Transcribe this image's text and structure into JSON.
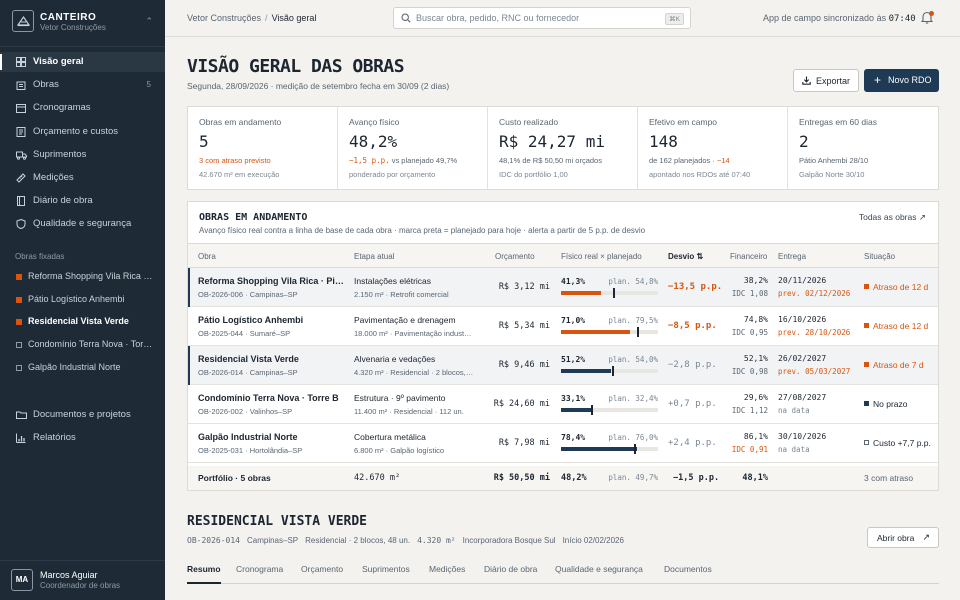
{
  "brand": {
    "name": "CANTEIRO",
    "org": "Vetor Construções",
    "switch_icon": "chevron-updown-icon"
  },
  "nav": [
    {
      "label": "Visão geral",
      "icon": "grid-icon",
      "active": true
    },
    {
      "label": "Obras",
      "icon": "building-icon",
      "count": "5"
    },
    {
      "label": "Cronogramas",
      "icon": "calendar-icon"
    },
    {
      "label": "Orçamento e custos",
      "icon": "ledger-icon"
    },
    {
      "label": "Suprimentos",
      "icon": "truck-icon"
    },
    {
      "label": "Medições",
      "icon": "ruler-icon"
    },
    {
      "label": "Diário de obra",
      "icon": "notebook-icon"
    },
    {
      "label": "Qualidade e segurança",
      "icon": "shield-icon"
    }
  ],
  "pinned_title": "Obras fixadas",
  "pinned": [
    {
      "label": "Reforma Shopping Vila Rica · Piso…",
      "color": "#d8550f"
    },
    {
      "label": "Pátio Logístico Anhembi",
      "color": "#d8550f"
    },
    {
      "label": "Residencial Vista Verde",
      "color": "#d8550f",
      "active": true
    },
    {
      "label": "Condomínio Terra Nova · Torr…",
      "color": "outline"
    },
    {
      "label": "Galpão Industrial Norte",
      "color": "outline"
    }
  ],
  "nav_bottom": [
    {
      "label": "Documentos e projetos",
      "icon": "folder-icon"
    },
    {
      "label": "Relatórios",
      "icon": "bar-chart-icon"
    }
  ],
  "user": {
    "initials": "MA",
    "name": "Marcos Aguiar",
    "role": "Coordenador de obras"
  },
  "topbar": {
    "breadcrumb_org": "Vetor Construções",
    "breadcrumb_sep": "/",
    "breadcrumb_current": "Visão geral",
    "search_placeholder": "Buscar obra, pedido, RNC ou fornecedor",
    "search_shortcut": "⌘K",
    "sync_label": "App de campo sincronizado às",
    "sync_time": "07:40"
  },
  "header": {
    "title": "VISÃO GERAL DAS OBRAS",
    "subtitle": "Segunda, 28/09/2026 · medição de setembro fecha em 30/09 (2 dias)",
    "export_label": "Exportar",
    "new_label": "Novo RDO"
  },
  "kpis": [
    {
      "label": "Obras em andamento",
      "value": "5",
      "line1": "3 com atraso previsto",
      "line1_accent": true,
      "line2": "42.670 m² em execução"
    },
    {
      "label": "Avanço físico",
      "value": "48,2%",
      "line1_accent_part": "−1,5 p.p.",
      "line1_rest": " vs planejado 49,7%",
      "line2": "ponderado por orçamento"
    },
    {
      "label": "Custo realizado",
      "value": "R$ 24,27 mi",
      "line1": "48,1% de R$ 50,50 mi orçados",
      "line2": "IDC do portfólio 1,00"
    },
    {
      "label": "Efetivo em campo",
      "value": "148",
      "line1_pre": "de 162 planejados · ",
      "line1_accent_tail": "−14",
      "line2": "apontado nos RDOs até 07:40"
    },
    {
      "label": "Entregas em 60 dias",
      "value": "2",
      "line1": "Pátio Anhembi 28/10",
      "line2": "Galpão Norte 30/10"
    }
  ],
  "table": {
    "title": "OBRAS EM ANDAMENTO",
    "subtitle": "Avanço físico real contra a linha de base de cada obra · marca preta = planejado para hoje · alerta a partir de 5 p.p. de desvio",
    "link": "Todas as obras",
    "columns": {
      "obra": "Obra",
      "etapa": "Etapa atual",
      "orcamento": "Orçamento",
      "fisico": "Físico real × planejado",
      "desvio": "Desvio",
      "financeiro": "Financeiro",
      "entrega": "Entrega",
      "situacao": "Situação"
    },
    "rows": [
      {
        "name": "Reforma Shopping Vila Rica · Piso…",
        "code": "OB-2026-006 · Campinas–SP",
        "stage": "Instalações elétricas",
        "stage2": "2.150 m² · Retrofit comercial",
        "budget": "R$ 3,12 mi",
        "real": "41,3%",
        "plan": "plan. 54,8%",
        "real_pct": 41.3,
        "plan_pct": 54.8,
        "dev": "−13,5 p.p.",
        "dev_alert": true,
        "fin": "38,2%",
        "idc": "IDC 1,08",
        "idc_alert": false,
        "delivery": "20/11/2026",
        "delivery2": "prev. 02/12/2026",
        "delivery2_alert": true,
        "status": "Atraso de 12 d",
        "status_kind": "late",
        "selected": true
      },
      {
        "name": "Pátio Logístico Anhembi",
        "code": "OB-2025-044 · Sumaré–SP",
        "stage": "Pavimentação e drenagem",
        "stage2": "18.000 m² · Pavimentação indust…",
        "budget": "R$ 5,34 mi",
        "real": "71,0%",
        "plan": "plan. 79,5%",
        "real_pct": 71.0,
        "plan_pct": 79.5,
        "dev": "−8,5 p.p.",
        "dev_alert": true,
        "fin": "74,8%",
        "idc": "IDC 0,95",
        "idc_alert": false,
        "delivery": "16/10/2026",
        "delivery2": "prev. 28/10/2026",
        "delivery2_alert": true,
        "status": "Atraso de 12 d",
        "status_kind": "late",
        "selected": false
      },
      {
        "name": "Residencial Vista Verde",
        "code": "OB-2026-014 · Campinas–SP",
        "stage": "Alvenaria e vedações",
        "stage2": "4.320 m² · Residencial · 2 blocos,…",
        "budget": "R$ 9,46 mi",
        "real": "51,2%",
        "plan": "plan. 54,0%",
        "real_pct": 51.2,
        "plan_pct": 54.0,
        "dev": "−2,8 p.p.",
        "dev_alert": false,
        "fin": "52,1%",
        "idc": "IDC 0,98",
        "idc_alert": false,
        "delivery": "26/02/2027",
        "delivery2": "prev. 05/03/2027",
        "delivery2_alert": true,
        "status": "Atraso de 7 d",
        "status_kind": "late",
        "selected": true
      },
      {
        "name": "Condomínio Terra Nova · Torre B",
        "code": "OB-2026-002 · Valinhos–SP",
        "stage": "Estrutura · 9º pavimento",
        "stage2": "11.400 m² · Residencial · 112 un.",
        "budget": "R$ 24,60 mi",
        "real": "33,1%",
        "plan": "plan. 32,4%",
        "real_pct": 33.1,
        "plan_pct": 32.4,
        "dev": "+0,7 p.p.",
        "dev_alert": false,
        "fin": "29,6%",
        "idc": "IDC 1,12",
        "idc_alert": false,
        "delivery": "27/08/2027",
        "delivery2": "na data",
        "delivery2_alert": false,
        "status": "No prazo",
        "status_kind": "ok",
        "selected": false
      },
      {
        "name": "Galpão Industrial Norte",
        "code": "OB-2025-031 · Hortolândia–SP",
        "stage": "Cobertura metálica",
        "stage2": "6.800 m² · Galpão logístico",
        "budget": "R$ 7,98 mi",
        "real": "78,4%",
        "plan": "plan. 76,0%",
        "real_pct": 78.4,
        "plan_pct": 76.0,
        "dev": "+2,4 p.p.",
        "dev_alert": false,
        "fin": "86,1%",
        "idc": "IDC 0,91",
        "idc_alert": true,
        "delivery": "30/10/2026",
        "delivery2": "na data",
        "delivery2_alert": false,
        "status": "Custo +7,7 p.p.",
        "status_kind": "cost",
        "selected": false
      }
    ],
    "footer": {
      "label": "Portfólio · 5 obras",
      "area": "42.670 m²",
      "budget": "R$ 50,50 mi",
      "real": "48,2%",
      "plan": "plan. 49,7%",
      "dev": "−1,5 p.p.",
      "fin": "48,1%",
      "status": "3 com atraso"
    }
  },
  "detail": {
    "title": "RESIDENCIAL VISTA VERDE",
    "code": "OB-2026-014",
    "city": "Campinas–SP",
    "type": "Residencial · 2 blocos, 48 un.",
    "area": "4.320 m²",
    "client": "Incorporadora Bosque Sul",
    "start": "Início 02/02/2026",
    "open_label": "Abrir obra",
    "tabs": [
      "Resumo",
      "Cronograma",
      "Orçamento",
      "Suprimentos",
      "Medições",
      "Diário de obra",
      "Qualidade e segurança",
      "Documentos"
    ]
  },
  "colors": {
    "accent": "#d8550f",
    "navy": "#1e3a55",
    "sidebar": "#1e2a35",
    "ok": "#1e3a55"
  }
}
